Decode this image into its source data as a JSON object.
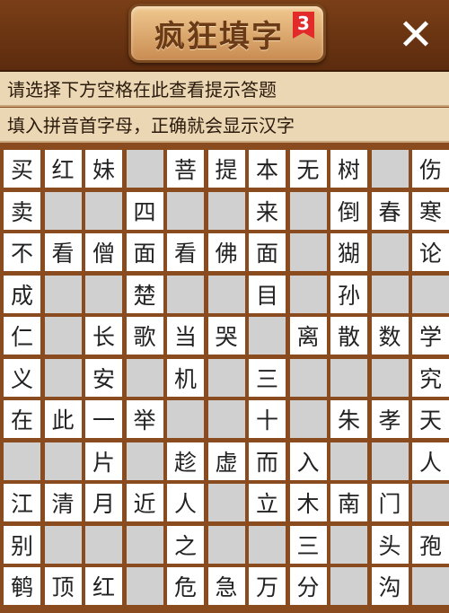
{
  "header": {
    "title": "疯狂填字",
    "level": "3",
    "close_icon": "close-icon"
  },
  "hints": {
    "line1": "请选择下方空格在此查看提示答题",
    "line2": "填入拼音首字母，正确就会显示汉字"
  },
  "grid": [
    [
      "买",
      "红",
      "妹",
      "",
      "菩",
      "提",
      "本",
      "无",
      "树",
      "",
      "伤"
    ],
    [
      "卖",
      "",
      "",
      "四",
      "",
      "",
      "来",
      "",
      "倒",
      "春",
      "寒"
    ],
    [
      "不",
      "看",
      "僧",
      "面",
      "看",
      "佛",
      "面",
      "",
      "猢",
      "",
      "论"
    ],
    [
      "成",
      "",
      "",
      "楚",
      "",
      "",
      "目",
      "",
      "孙",
      "",
      ""
    ],
    [
      "仁",
      "",
      "长",
      "歌",
      "当",
      "哭",
      "",
      "离",
      "散",
      "数",
      "学"
    ],
    [
      "义",
      "",
      "安",
      "",
      "机",
      "",
      "三",
      "",
      "",
      "",
      "究"
    ],
    [
      "在",
      "此",
      "一",
      "举",
      "",
      "",
      "十",
      "",
      "朱",
      "孝",
      "天"
    ],
    [
      "",
      "",
      "片",
      "",
      "趁",
      "虚",
      "而",
      "入",
      "",
      "",
      "人"
    ],
    [
      "江",
      "清",
      "月",
      "近",
      "人",
      "",
      "立",
      "木",
      "南",
      "门",
      ""
    ],
    [
      "别",
      "",
      "",
      "",
      "之",
      "",
      "",
      "三",
      "",
      "头",
      "孢"
    ],
    [
      "鹌",
      "顶",
      "红",
      "",
      "危",
      "急",
      "万",
      "分",
      "",
      "沟",
      ""
    ]
  ],
  "cell_states": [
    [
      1,
      1,
      1,
      0,
      1,
      1,
      1,
      1,
      1,
      0,
      1
    ],
    [
      1,
      0,
      0,
      1,
      0,
      0,
      1,
      0,
      1,
      1,
      1
    ],
    [
      1,
      1,
      1,
      1,
      1,
      1,
      1,
      0,
      1,
      0,
      1
    ],
    [
      1,
      0,
      0,
      1,
      0,
      0,
      1,
      0,
      1,
      0,
      0
    ],
    [
      1,
      0,
      1,
      1,
      1,
      1,
      0,
      1,
      1,
      1,
      1
    ],
    [
      1,
      0,
      1,
      0,
      1,
      0,
      1,
      0,
      0,
      0,
      1
    ],
    [
      1,
      1,
      1,
      1,
      0,
      0,
      1,
      0,
      1,
      1,
      1
    ],
    [
      0,
      0,
      1,
      0,
      1,
      1,
      1,
      1,
      0,
      0,
      1
    ],
    [
      1,
      1,
      1,
      1,
      1,
      0,
      1,
      1,
      1,
      1,
      0
    ],
    [
      1,
      0,
      0,
      0,
      1,
      0,
      0,
      1,
      0,
      1,
      1
    ],
    [
      1,
      1,
      1,
      0,
      1,
      1,
      1,
      1,
      0,
      1,
      0
    ]
  ]
}
